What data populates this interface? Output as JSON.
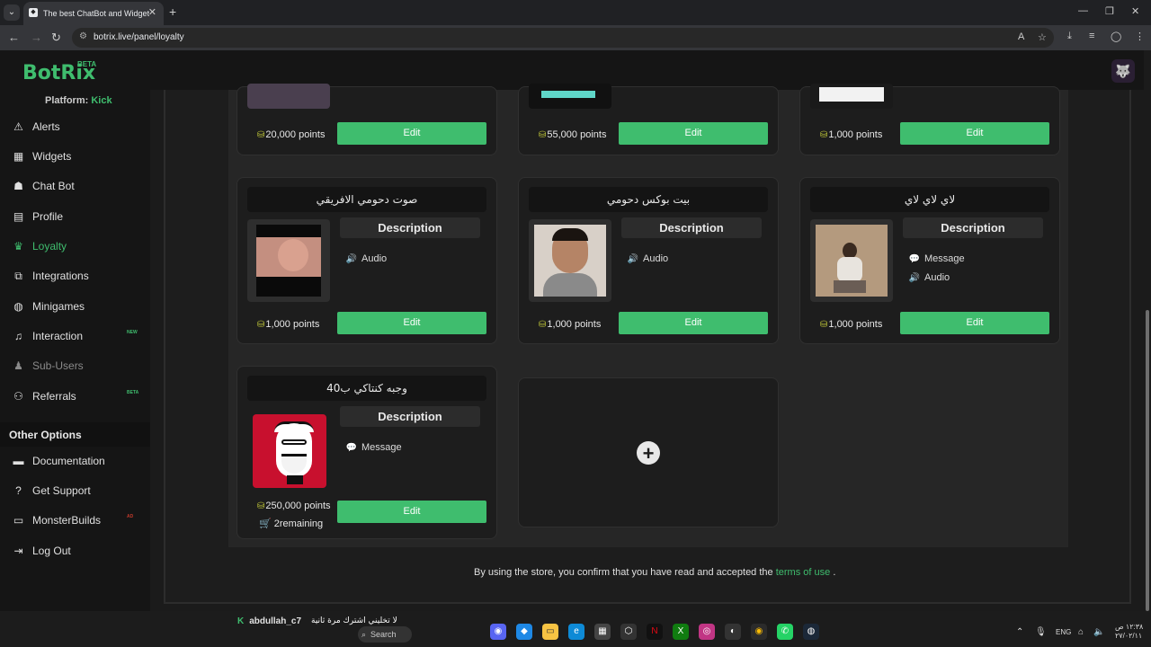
{
  "browser": {
    "tab_title": "The best ChatBot and Widgets",
    "url": "botrix.live/panel/loyalty"
  },
  "app": {
    "logo": "BotRix",
    "logo_badge": "BETA",
    "platform_label": "Platform:",
    "platform_value": "Kick"
  },
  "sidebar": {
    "items": [
      {
        "label": "Alerts",
        "icon": "warning-icon"
      },
      {
        "label": "Widgets",
        "icon": "grid-icon"
      },
      {
        "label": "Chat Bot",
        "icon": "robot-icon"
      },
      {
        "label": "Profile",
        "icon": "id-card-icon"
      },
      {
        "label": "Loyalty",
        "icon": "trophy-icon",
        "active": true
      },
      {
        "label": "Integrations",
        "icon": "integration-icon"
      },
      {
        "label": "Minigames",
        "icon": "gamepad-icon"
      },
      {
        "label": "Interaction",
        "icon": "music-icon",
        "badge": "NEW"
      },
      {
        "label": "Sub-Users",
        "icon": "users-icon",
        "disabled": true
      },
      {
        "label": "Referrals",
        "icon": "referral-icon",
        "badge": "BETA"
      }
    ],
    "other_options_title": "Other Options",
    "other_items": [
      {
        "label": "Documentation",
        "icon": "book-icon"
      },
      {
        "label": "Get Support",
        "icon": "question-icon"
      },
      {
        "label": "MonsterBuilds",
        "icon": "laptop-icon",
        "badge": "AD"
      },
      {
        "label": "Log Out",
        "icon": "logout-icon"
      }
    ]
  },
  "store": {
    "description_label": "Description",
    "edit_label": "Edit",
    "top_row_points": [
      "20,000 points",
      "55,000 points",
      "1,000 points"
    ],
    "items": [
      {
        "title": "صوت دحومي الافريقي",
        "points": "1,000 points",
        "features": [
          {
            "icon": "volume-icon",
            "label": "Audio"
          }
        ]
      },
      {
        "title": "بيت بوكس دحومي",
        "points": "1,000 points",
        "features": [
          {
            "icon": "volume-icon",
            "label": "Audio"
          }
        ]
      },
      {
        "title": "لاي لاي لاي",
        "points": "1,000 points",
        "features": [
          {
            "icon": "comment-icon",
            "label": "Message"
          },
          {
            "icon": "volume-icon",
            "label": "Audio"
          }
        ]
      },
      {
        "title": "وجبه كنتاكي ب40",
        "points": "250,000 points",
        "remaining": "2remaining",
        "features": [
          {
            "icon": "comment-icon",
            "label": "Message"
          }
        ]
      }
    ],
    "terms_prefix": "By using the store, you confirm that you have read and accepted the",
    "terms_link": "terms of use",
    "terms_suffix": "."
  },
  "taskbar": {
    "chat_username": "abdullah_c7",
    "chat_message": "لا تخليني اشترك مرة ثانية",
    "search_label": "Search",
    "language": "ENG",
    "time": "١٢:٣٨ ص",
    "date": "٢٧/٠٢/١١"
  },
  "colors": {
    "accent": "#3fbd6e",
    "background": "#1b1b1b",
    "card": "#1d1d1d"
  }
}
